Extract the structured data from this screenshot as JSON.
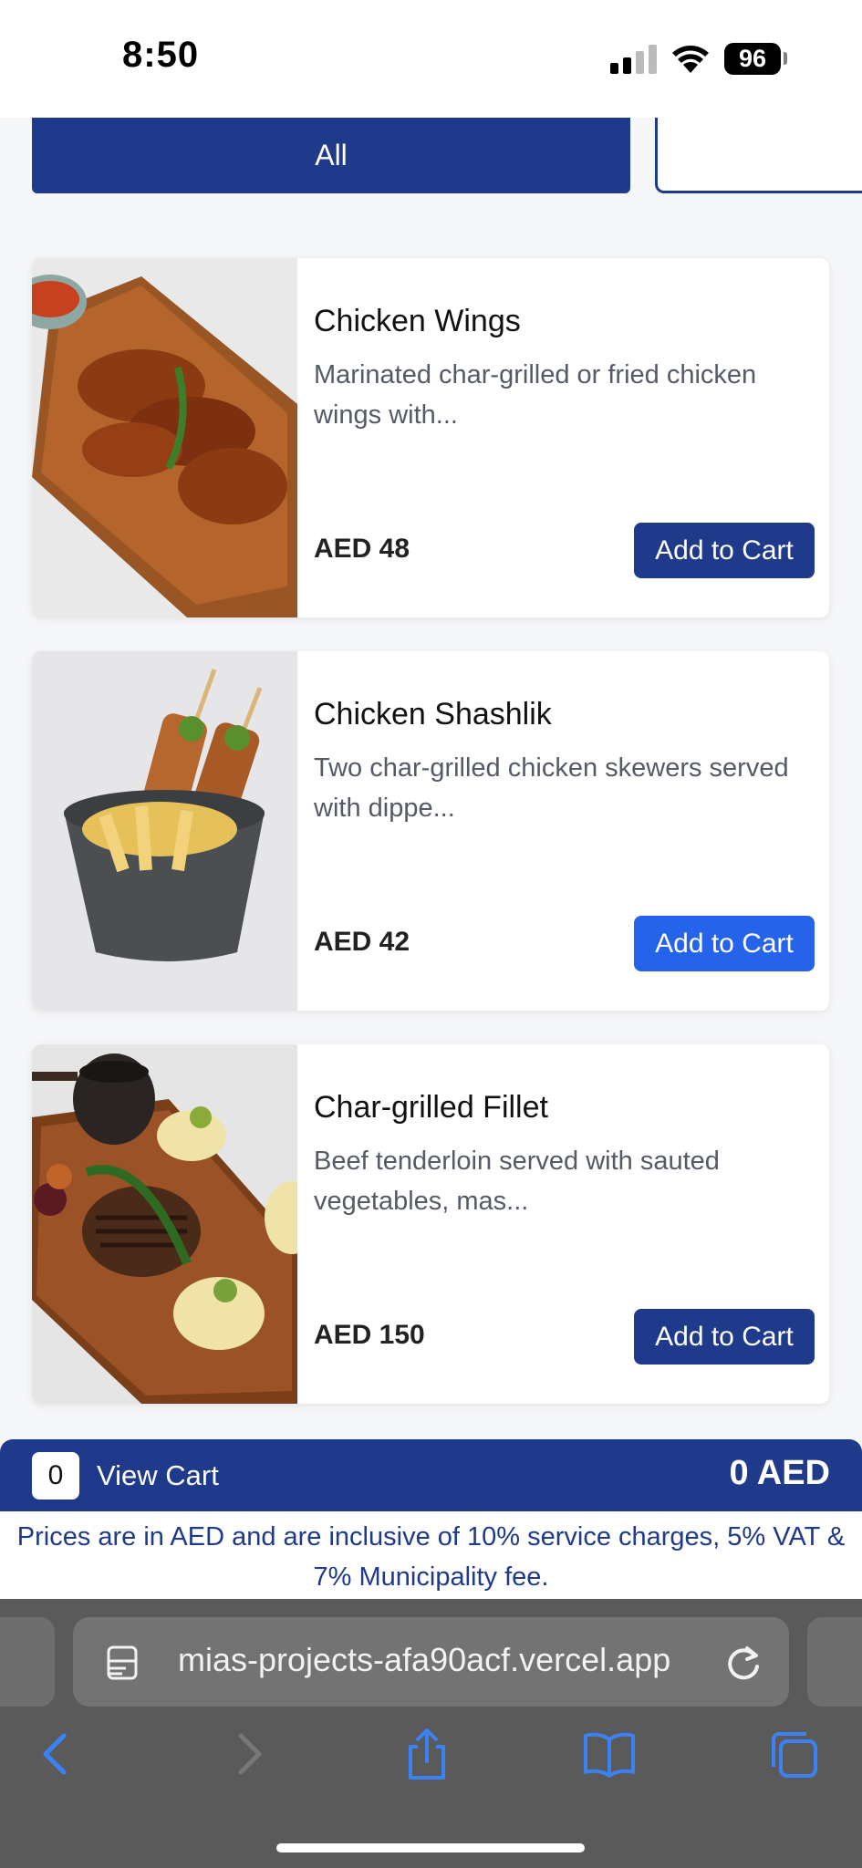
{
  "status": {
    "time": "8:50",
    "battery": "96"
  },
  "categories": {
    "active": "All"
  },
  "items": [
    {
      "title": "Chicken Wings",
      "description": "Marinated char-grilled or fried chicken wings with...",
      "price": "AED 48",
      "button": "Add to Cart"
    },
    {
      "title": "Chicken Shashlik",
      "description": "Two char-grilled chicken skewers served with dippe...",
      "price": "AED 42",
      "button": "Add to Cart"
    },
    {
      "title": "Char-grilled Fillet",
      "description": "Beef tenderloin served with sauted vegetables, mas...",
      "price": "AED 150",
      "button": "Add to Cart"
    }
  ],
  "cart": {
    "count": "0",
    "label": "View Cart",
    "total": "0 AED"
  },
  "notice": "Prices are in AED and are inclusive of 10% service charges, 5% VAT & 7% Municipality fee.",
  "browser": {
    "url": "mias-projects-afa90acf.vercel.app"
  },
  "colors": {
    "primary": "#1f3a8a",
    "button_active": "#2563eb",
    "browser_chrome": "#5a5a5a"
  }
}
